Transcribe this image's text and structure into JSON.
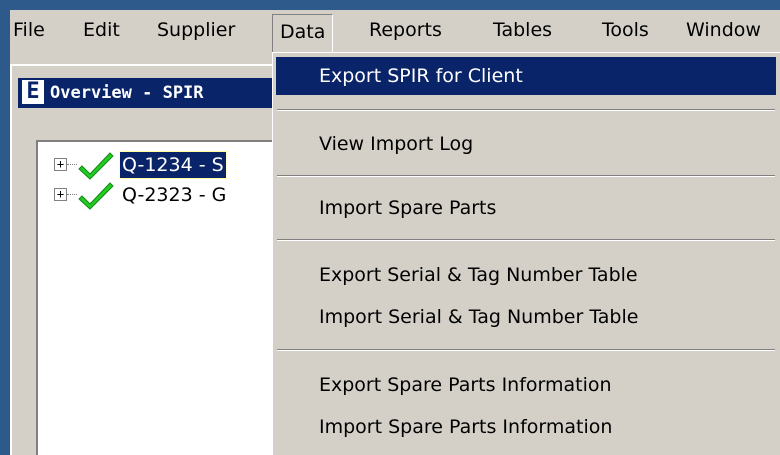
{
  "menubar": {
    "items": [
      {
        "label": "File"
      },
      {
        "label": "Edit"
      },
      {
        "label": "Supplier"
      },
      {
        "label": "Data"
      },
      {
        "label": "Reports"
      },
      {
        "label": "Tables"
      },
      {
        "label": "Tools"
      },
      {
        "label": "Window"
      }
    ]
  },
  "overview": {
    "title": "Overview - SPIR",
    "icon_letter": "E",
    "tree": [
      {
        "label": "Q-1234 - S",
        "selected": true,
        "icon": "green-check-icon"
      },
      {
        "label": "Q-2323 - G",
        "selected": false,
        "icon": "green-check-icon"
      }
    ]
  },
  "data_menu": {
    "items": [
      {
        "label": "Export SPIR for Client",
        "highlighted": true
      },
      {
        "label": "View Import Log"
      },
      {
        "label": "Import Spare Parts"
      },
      {
        "label": "Export Serial & Tag Number Table"
      },
      {
        "label": "Import Serial & Tag Number Table"
      },
      {
        "label": "Export Spare Parts Information"
      },
      {
        "label": "Import Spare Parts Information"
      }
    ]
  },
  "colors": {
    "desktop": "#2e5a8b",
    "face": "#d4d0c8",
    "highlight": "#0a246a",
    "check": "#22cc22"
  }
}
